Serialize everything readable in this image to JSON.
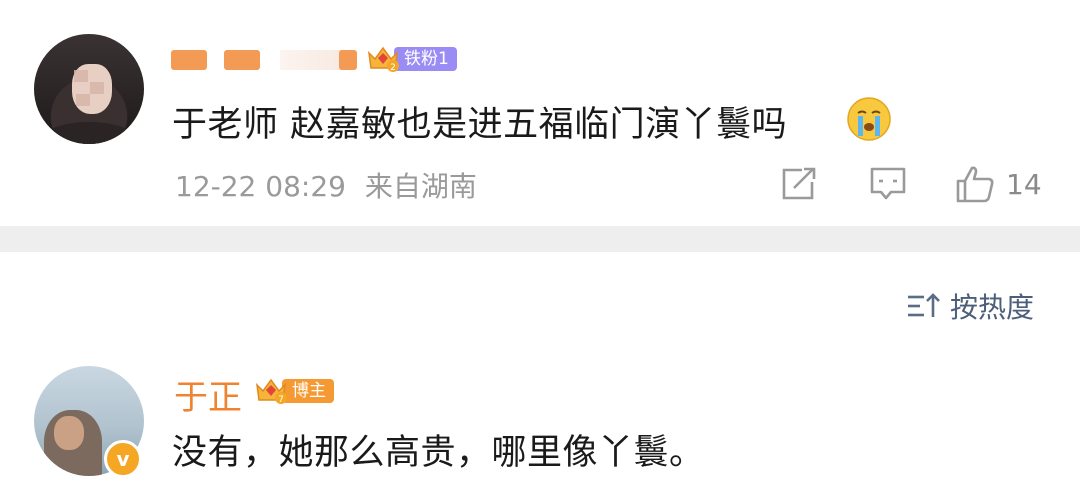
{
  "comment": {
    "badge_label": "铁粉1",
    "text": "于老师 赵嘉敏也是进五福临门演丫鬟吗",
    "timestamp": "12-22 08:29",
    "location": "来自湖南",
    "like_count": "14",
    "icons": [
      "share-icon",
      "comment-icon",
      "like-icon",
      "crying-emoji-icon"
    ]
  },
  "sort": {
    "label": "按热度",
    "icon": "sort-icon"
  },
  "reply": {
    "author": "于正",
    "badge_label": "博主",
    "text": "没有，她那么高贵，哪里像丫鬟。",
    "verified_mark": "v"
  },
  "colors": {
    "fan_badge": "#9b8cf5",
    "owner_badge": "#f59a32",
    "author_name": "#f0832f",
    "meta_gray": "#9a9a9a",
    "divider": "#eeeeee",
    "sort_blue": "#4c5e7a"
  }
}
